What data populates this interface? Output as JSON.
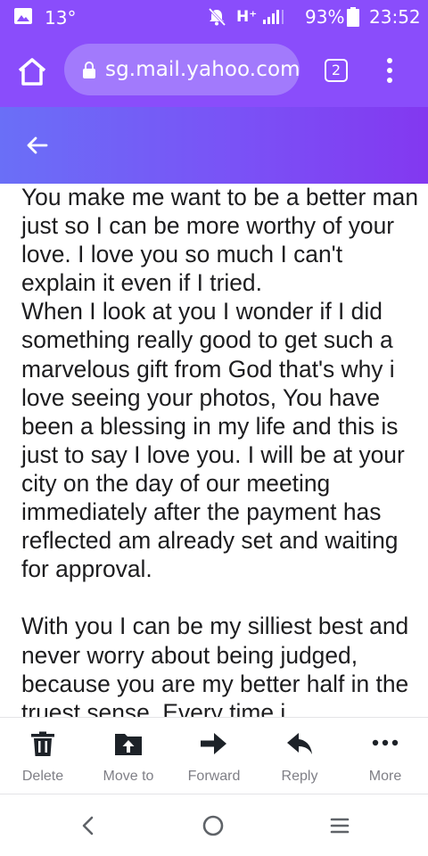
{
  "status_bar": {
    "temperature": "13°",
    "network": "H⁺",
    "battery": "93%",
    "time": "23:52"
  },
  "browser": {
    "url": "sg.mail.yahoo.com",
    "tab_count": "2",
    "icons": [
      "home-icon",
      "lock-icon",
      "tabs-icon",
      "more-vert-icon"
    ]
  },
  "message": {
    "paragraphs": [
      "You make me want to be a better man just so I can be more worthy of your love. I love you so much I can't explain it even if I tried.",
      "When I look at you I wonder if I did something really good to get such a marvelous gift from God that's why i love seeing your photos, You have been a blessing in my life and this is just to say I love you. I will be at your city on the day of our meeting immediately after the payment has reflected am already set and waiting for approval.",
      "With you I can be my silliest best and never worry about being judged, because you are my better half in the truest sense. Every time i"
    ]
  },
  "actions": {
    "delete": "Delete",
    "move_to": "Move to",
    "forward": "Forward",
    "reply": "Reply",
    "more": "More"
  },
  "colors": {
    "chrome": "#8a4dfb",
    "url_pill": "#a27afc",
    "app_bar_start": "#6a6ff7",
    "app_bar_end": "#8338f0",
    "action_icon": "#1d2228",
    "action_label": "#7f7f86"
  }
}
